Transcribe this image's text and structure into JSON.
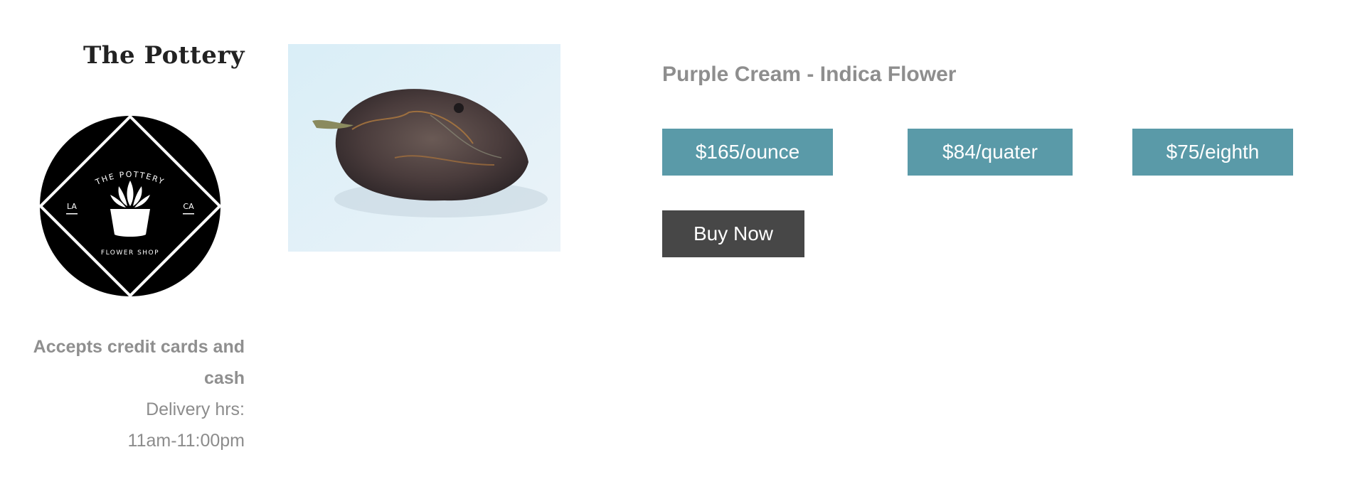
{
  "store": {
    "name": "The Pottery",
    "logo": {
      "top_text": "THE POTTERY",
      "left_text": "LA",
      "right_text": "CA",
      "bottom_text": "FLOWER SHOP",
      "icon": "succulent-pot-icon"
    },
    "payments": "Accepts credit cards and cash",
    "delivery_label": "Delivery hrs:",
    "delivery_hours": "11am-11:00pm"
  },
  "product": {
    "name": "Purple Cream - Indica Flower",
    "image_icon": "cannabis-bud-photo",
    "prices": [
      {
        "label": "$165/ounce"
      },
      {
        "label": "$84/quater"
      },
      {
        "label": "$75/eighth"
      }
    ],
    "buy_label": "Buy Now"
  },
  "colors": {
    "price_button": "#5a9aa8",
    "buy_button": "#474747",
    "heading_gray": "#8e8e8e",
    "title_dark": "#222222"
  }
}
